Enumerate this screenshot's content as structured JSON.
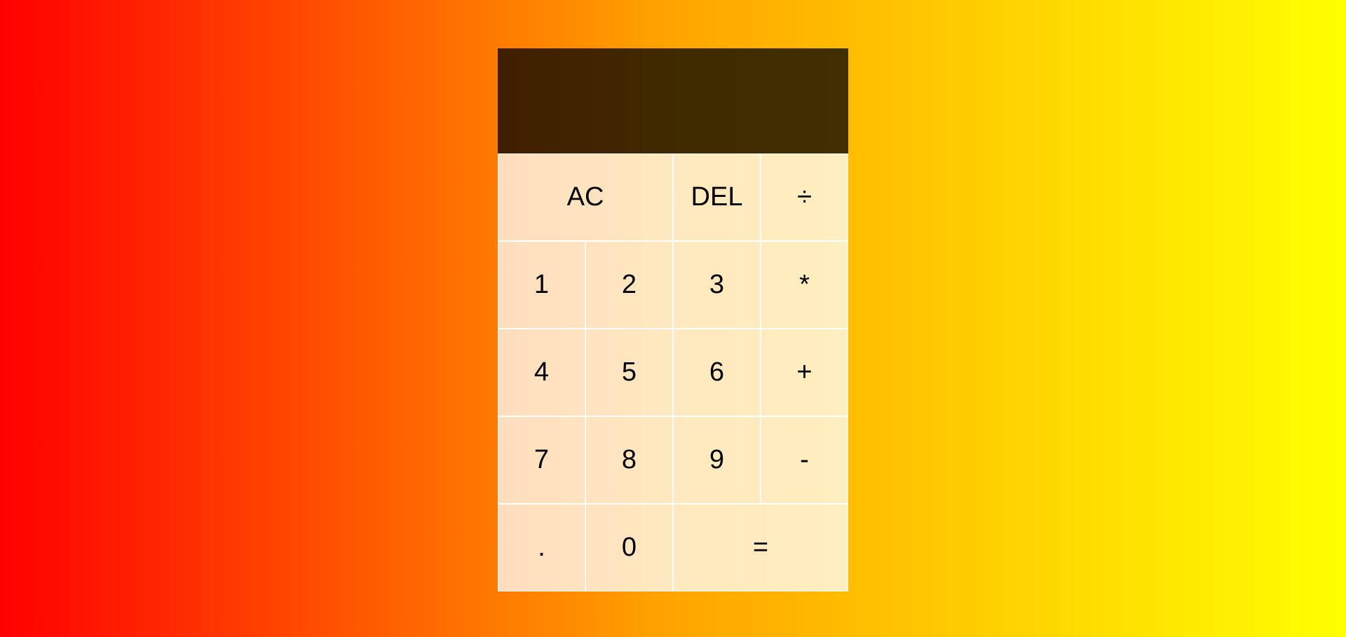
{
  "calculator": {
    "display": {
      "previous_operand": "",
      "current_operand": ""
    },
    "keys": {
      "all_clear": "AC",
      "delete": "DEL",
      "divide": "÷",
      "one": "1",
      "two": "2",
      "three": "3",
      "multiply": "*",
      "four": "4",
      "five": "5",
      "six": "6",
      "add": "+",
      "seven": "7",
      "eight": "8",
      "nine": "9",
      "subtract": "-",
      "decimal": ".",
      "zero": "0",
      "equals": "="
    }
  },
  "colors": {
    "background_left": "#ff0000",
    "background_mid": "#ffa500",
    "background_right": "#ffff00",
    "display_bg": "rgba(0,0,0,0.75)",
    "key_bg": "rgba(255,255,255,0.75)",
    "key_border": "#ffffff"
  }
}
